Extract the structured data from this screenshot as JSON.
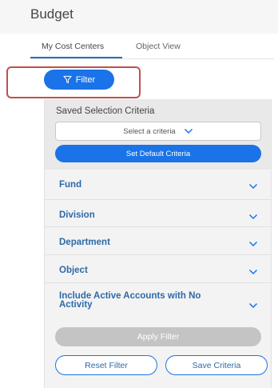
{
  "page": {
    "title": "Budget"
  },
  "tabs": [
    {
      "label": "My Cost Centers",
      "active": true
    },
    {
      "label": "Object View",
      "active": false
    }
  ],
  "filter_button": {
    "label": "Filter",
    "icon": "filter-icon"
  },
  "saved_criteria": {
    "heading": "Saved Selection Criteria",
    "select_placeholder": "Select a criteria",
    "default_button_label": "Set Default Criteria"
  },
  "filters": {
    "fund": "Fund",
    "division": "Division",
    "department": "Department",
    "object": "Object",
    "include_active": "Include Active Accounts with No Activity"
  },
  "actions": {
    "apply": "Apply Filter",
    "reset": "Reset Filter",
    "save": "Save Criteria"
  },
  "colors": {
    "primary": "#1a73e8",
    "link": "#2c6aa8",
    "highlight": "#c0504d",
    "disabled": "#c4c4c4"
  }
}
